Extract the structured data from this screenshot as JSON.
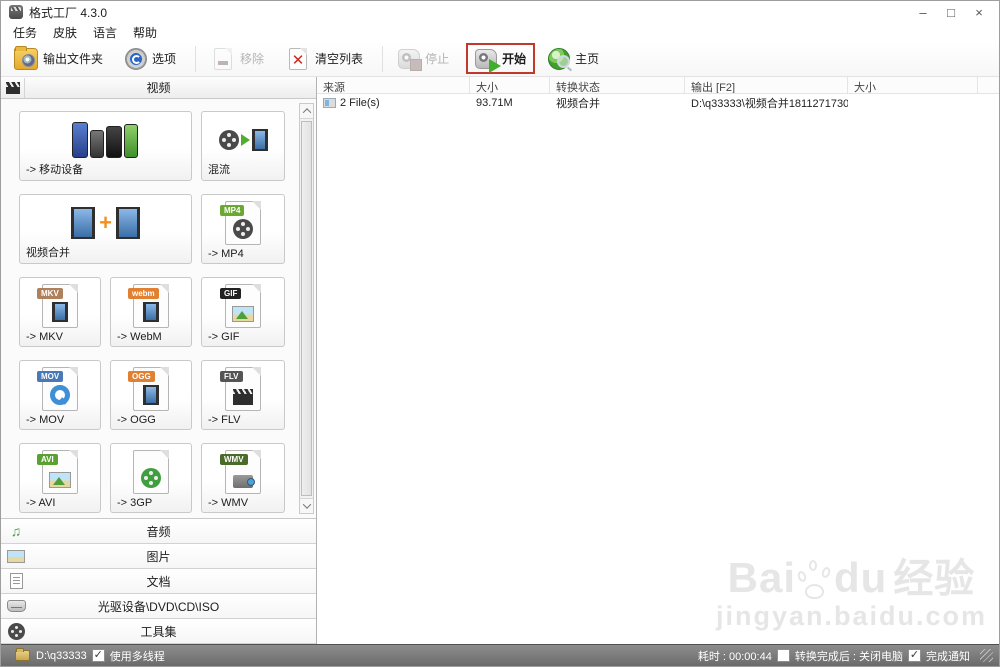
{
  "window": {
    "title": "格式工厂 4.3.0",
    "minimize": "–",
    "maximize": "□",
    "close": "×"
  },
  "menu": {
    "items": [
      {
        "name": "tasks",
        "label": "任务"
      },
      {
        "name": "skin",
        "label": "皮肤"
      },
      {
        "name": "language",
        "label": "语言"
      },
      {
        "name": "help",
        "label": "帮助"
      }
    ]
  },
  "toolbar": {
    "buttons": [
      {
        "name": "output-folder",
        "label": "输出文件夹",
        "icon": "folder",
        "disabled": false,
        "highlighted": false
      },
      {
        "name": "options",
        "label": "选项",
        "icon": "gear",
        "disabled": false,
        "highlighted": false
      },
      {
        "sep": true
      },
      {
        "name": "remove",
        "label": "移除",
        "icon": "page-minus",
        "disabled": true,
        "highlighted": false
      },
      {
        "name": "clear-list",
        "label": "清空列表",
        "icon": "page-cross",
        "disabled": false,
        "highlighted": false
      },
      {
        "sep": true
      },
      {
        "name": "stop",
        "label": "停止",
        "icon": "stop",
        "disabled": true,
        "highlighted": false
      },
      {
        "name": "start",
        "label": "开始",
        "icon": "start",
        "disabled": false,
        "highlighted": true
      },
      {
        "name": "home",
        "label": "主页",
        "icon": "globe",
        "disabled": false,
        "highlighted": false
      }
    ],
    "highlight_color": "#c0392b"
  },
  "sidebar": {
    "video_header": "视频",
    "cards": [
      {
        "name": "mobile-devices",
        "label": "-> 移动设备",
        "icon": "phones",
        "wide": true
      },
      {
        "name": "mux",
        "label": "混流",
        "icon": "mux",
        "wide": false
      },
      {
        "name": "video-join",
        "label": "视频合并",
        "icon": "vjoin",
        "wide": true
      },
      {
        "name": "to-mp4",
        "label": "-> MP4",
        "icon": "file",
        "badge": "MP4",
        "badge_color": "#6aa832",
        "glyph": "reel",
        "wide": false
      },
      {
        "name": "to-mkv",
        "label": "-> MKV",
        "icon": "file",
        "badge": "MKV",
        "badge_color": "#b0805a",
        "glyph": "film",
        "wide": false
      },
      {
        "name": "to-webm",
        "label": "-> WebM",
        "icon": "file",
        "badge": "webm",
        "badge_color": "#e08030",
        "glyph": "film",
        "wide": false
      },
      {
        "name": "to-gif",
        "label": "-> GIF",
        "icon": "file",
        "badge": "GIF",
        "badge_color": "#222222",
        "glyph": "picture",
        "wide": false
      },
      {
        "name": "to-mov",
        "label": "-> MOV",
        "icon": "file",
        "badge": "MOV",
        "badge_color": "#4a78b5",
        "glyph": "q",
        "wide": false
      },
      {
        "name": "to-ogg",
        "label": "-> OGG",
        "icon": "file",
        "badge": "OGG",
        "badge_color": "#e08030",
        "glyph": "film",
        "wide": false
      },
      {
        "name": "to-flv",
        "label": "-> FLV",
        "icon": "file",
        "badge": "FLV",
        "badge_color": "#555555",
        "glyph": "clapper",
        "wide": false
      },
      {
        "name": "to-avi",
        "label": "-> AVI",
        "icon": "file",
        "badge": "AVI",
        "badge_color": "#5aa032",
        "glyph": "picture",
        "wide": false
      },
      {
        "name": "to-3gp",
        "label": "-> 3GP",
        "icon": "file",
        "badge": "",
        "badge_color": "",
        "glyph": "reel-green",
        "wide": false
      },
      {
        "name": "to-wmv",
        "label": "-> WMV",
        "icon": "file",
        "badge": "WMV",
        "badge_color": "#4a6b2a",
        "glyph": "camcorder",
        "wide": false
      }
    ],
    "sections": [
      {
        "name": "audio",
        "label": "音频",
        "icon": "music"
      },
      {
        "name": "picture",
        "label": "图片",
        "icon": "picture"
      },
      {
        "name": "document",
        "label": "文档",
        "icon": "doc"
      },
      {
        "name": "rom-device",
        "label": "光驱设备\\DVD\\CD\\ISO",
        "icon": "disc"
      },
      {
        "name": "toolset",
        "label": "工具集",
        "icon": "tools"
      }
    ]
  },
  "table": {
    "columns": [
      "来源",
      "大小",
      "转换状态",
      "输出 [F2]",
      "大小",
      ""
    ],
    "rows": [
      {
        "source": "2 File(s)",
        "size": "93.71M",
        "status": "视频合并",
        "output": "D:\\q33333\\视频合并1811271730...",
        "size2": ""
      }
    ]
  },
  "statusbar": {
    "output_path": "D:\\q33333",
    "multithread_label": "使用多线程",
    "multithread_checked": true,
    "elapsed_label": "耗时 : 00:00:44",
    "shutdown_label": "转换完成后 : 关闭电脑",
    "shutdown_checked": false,
    "notify_label": "完成通知",
    "notify_checked": true
  },
  "watermark": {
    "brand_prefix": "Bai",
    "brand_suffix": "du",
    "brand_cn": "经验",
    "url": "jingyan.baidu.com"
  }
}
